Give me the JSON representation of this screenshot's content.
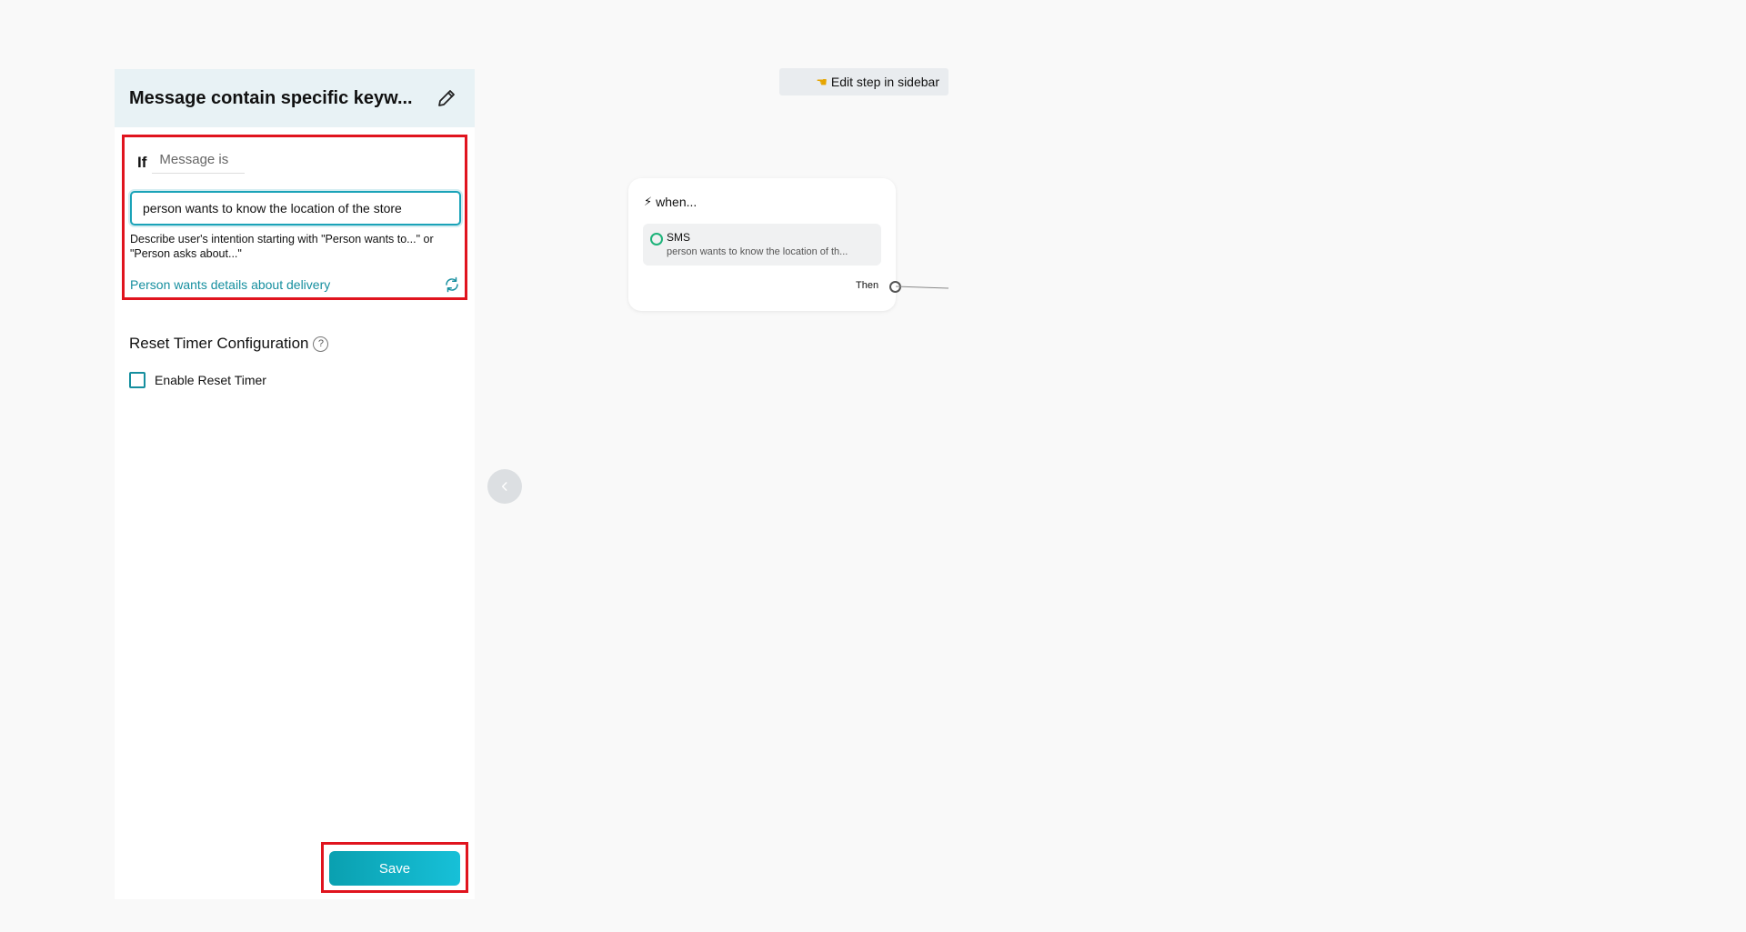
{
  "panel": {
    "title": "Message contain specific keyw...",
    "if_label": "If",
    "condition_type": "Message is",
    "input_value": "person wants to know the location of the store",
    "hint": "Describe user's intention starting with \"Person wants to...\" or \"Person asks about...\"",
    "suggestion": "Person wants details about delivery",
    "reset_title": "Reset Timer Configuration",
    "help_glyph": "?",
    "checkbox_label": "Enable Reset Timer",
    "checkbox_checked": false,
    "save_label": "Save"
  },
  "canvas": {
    "edit_hint": "Edit step in sidebar",
    "node": {
      "when_label": "when...",
      "trigger_channel": "SMS",
      "trigger_description": "person wants to know the location of th...",
      "then_label": "Then"
    }
  },
  "colors": {
    "accent": "#168f9f",
    "highlight_border": "#e0141e",
    "save_gradient_start": "#0aa0b0",
    "save_gradient_end": "#17c0d8",
    "sms_green": "#1db37a"
  },
  "icons": {
    "edit": "pencil-icon",
    "refresh": "refresh-icon",
    "help": "help-icon",
    "collapse": "chevron-left-icon",
    "hint": "pointing-hand-icon",
    "when": "lightning-icon",
    "sms": "sms-icon"
  }
}
